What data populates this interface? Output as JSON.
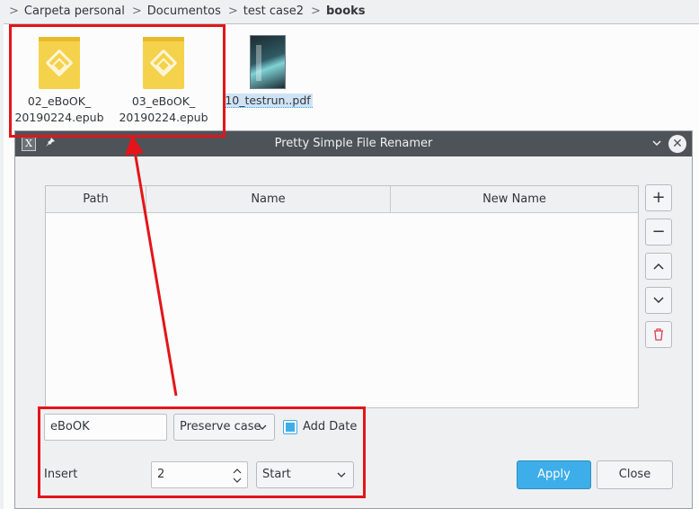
{
  "breadcrumb": {
    "items": [
      "Carpeta personal",
      "Documentos",
      "test case2"
    ],
    "current": "books",
    "separator": ">"
  },
  "files": [
    {
      "line1": "02_eBoOK_",
      "line2": "20190224.epub",
      "icon": "epub-icon"
    },
    {
      "line1": "03_eBoOK_",
      "line2": "20190224.epub",
      "icon": "epub-icon"
    },
    {
      "line1": "10_testrun..pdf",
      "icon": "pdf-thumbnail"
    }
  ],
  "dialog": {
    "title": "Pretty Simple File Renamer",
    "app_icon_glyph": "X",
    "pin_glyph": "✎",
    "chevron_glyph": "⌄",
    "close_glyph": "✕"
  },
  "table": {
    "columns": [
      "Path",
      "Name",
      "New Name"
    ]
  },
  "side_buttons": {
    "add": "+",
    "remove": "−",
    "up": "⌃",
    "down": "⌄",
    "delete_icon": "🗑"
  },
  "controls": {
    "search_value": "eBoOK",
    "case_option": "Preserve case",
    "add_date_label": "Add Date",
    "add_date_checked": true,
    "insert_label": "Insert",
    "insert_value": "2",
    "position_option": "Start",
    "apply_label": "Apply",
    "close_label": "Close"
  },
  "colors": {
    "accent": "#3daee9",
    "annotation_red": "#e3151a",
    "titlebar": "#4d5358"
  }
}
